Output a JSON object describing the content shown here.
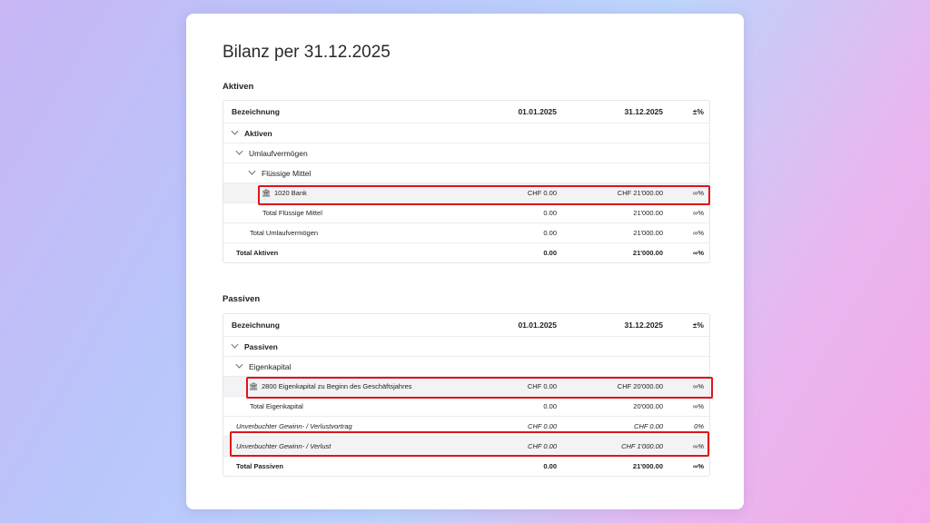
{
  "title": "Bilanz per 31.12.2025",
  "aktiven": {
    "heading": "Aktiven",
    "cols": {
      "name": "Bezeichnung",
      "a": "01.01.2025",
      "b": "31.12.2025",
      "p": "±%"
    },
    "rows": [
      {
        "name": "Aktiven",
        "a": "",
        "b": "",
        "p": ""
      },
      {
        "name": "Umlaufvermögen",
        "a": "",
        "b": "",
        "p": ""
      },
      {
        "name": "Flüssige Mittel",
        "a": "",
        "b": "",
        "p": ""
      },
      {
        "name": "1020 Bank",
        "a": "CHF 0.00",
        "b": "CHF 21'000.00",
        "p": "∞%"
      },
      {
        "name": "Total Flüssige Mittel",
        "a": "0.00",
        "b": "21'000.00",
        "p": "∞%"
      },
      {
        "name": "Total Umlaufvermögen",
        "a": "0.00",
        "b": "21'000.00",
        "p": "∞%"
      },
      {
        "name": "Total Aktiven",
        "a": "0.00",
        "b": "21'000.00",
        "p": "∞%"
      }
    ]
  },
  "passiven": {
    "heading": "Passiven",
    "cols": {
      "name": "Bezeichnung",
      "a": "01.01.2025",
      "b": "31.12.2025",
      "p": "±%"
    },
    "rows": [
      {
        "name": "Passiven",
        "a": "",
        "b": "",
        "p": ""
      },
      {
        "name": "Eigenkapital",
        "a": "",
        "b": "",
        "p": ""
      },
      {
        "name": "2800 Eigenkapital zu Beginn des Geschäftsjahres",
        "a": "CHF 0.00",
        "b": "CHF 20'000.00",
        "p": "∞%"
      },
      {
        "name": "Total Eigenkapital",
        "a": "0.00",
        "b": "20'000.00",
        "p": "∞%"
      },
      {
        "name": "Unverbuchter Gewinn- / Verlustvortrag",
        "a": "CHF 0.00",
        "b": "CHF 0.00",
        "p": "0%"
      },
      {
        "name": "Unverbuchter Gewinn- / Verlust",
        "a": "CHF 0.00",
        "b": "CHF 1'000.00",
        "p": "∞%"
      },
      {
        "name": "Total Passiven",
        "a": "0.00",
        "b": "21'000.00",
        "p": "∞%"
      }
    ]
  },
  "icons": {
    "expand": "chevron-down-icon",
    "account": "bank-icon"
  },
  "colors": {
    "highlight_border": "#e0131b",
    "row_highlight": "#f3f3f5"
  }
}
